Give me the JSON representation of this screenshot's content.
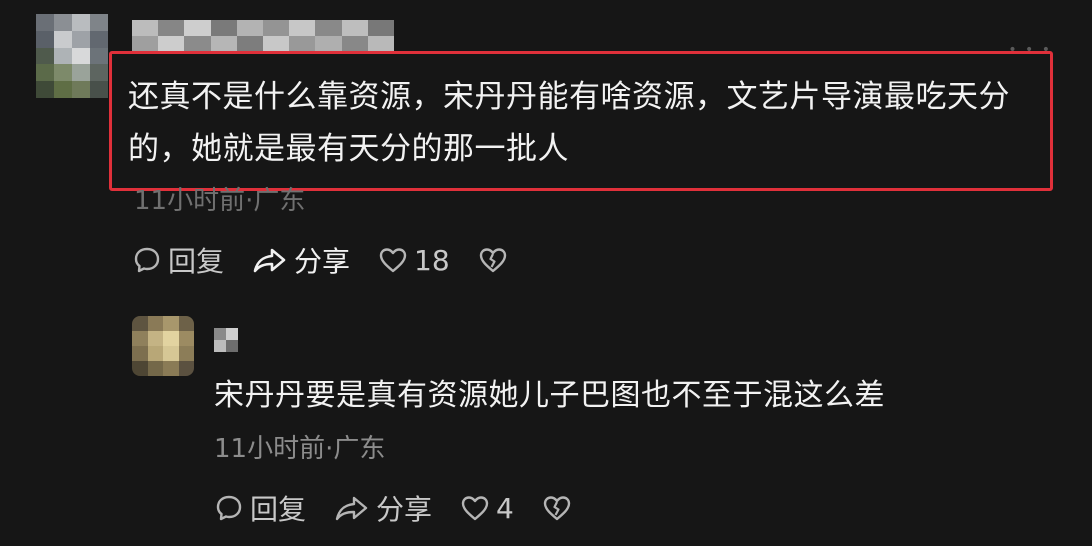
{
  "comment1": {
    "text": "还真不是什么靠资源，宋丹丹能有啥资源，文艺片导演最吃天分的，她就是最有天分的那一批人",
    "meta": "11小时前·广东",
    "reply_label": "回复",
    "share_label": "分享",
    "like_count": "18",
    "more_icon": "more-dots-icon"
  },
  "comment2": {
    "text": "宋丹丹要是真有资源她儿子巴图也不至于混这么差",
    "meta": "11小时前·广东",
    "reply_label": "回复",
    "share_label": "分享",
    "like_count": "4"
  },
  "colors": {
    "background": "#161616",
    "highlight_border": "#e0303a",
    "text_primary": "#f2f2f2",
    "text_meta": "#8c8c8c"
  },
  "icons": [
    "comment-bubble-icon",
    "share-arrow-icon",
    "heart-icon",
    "broken-heart-icon"
  ]
}
